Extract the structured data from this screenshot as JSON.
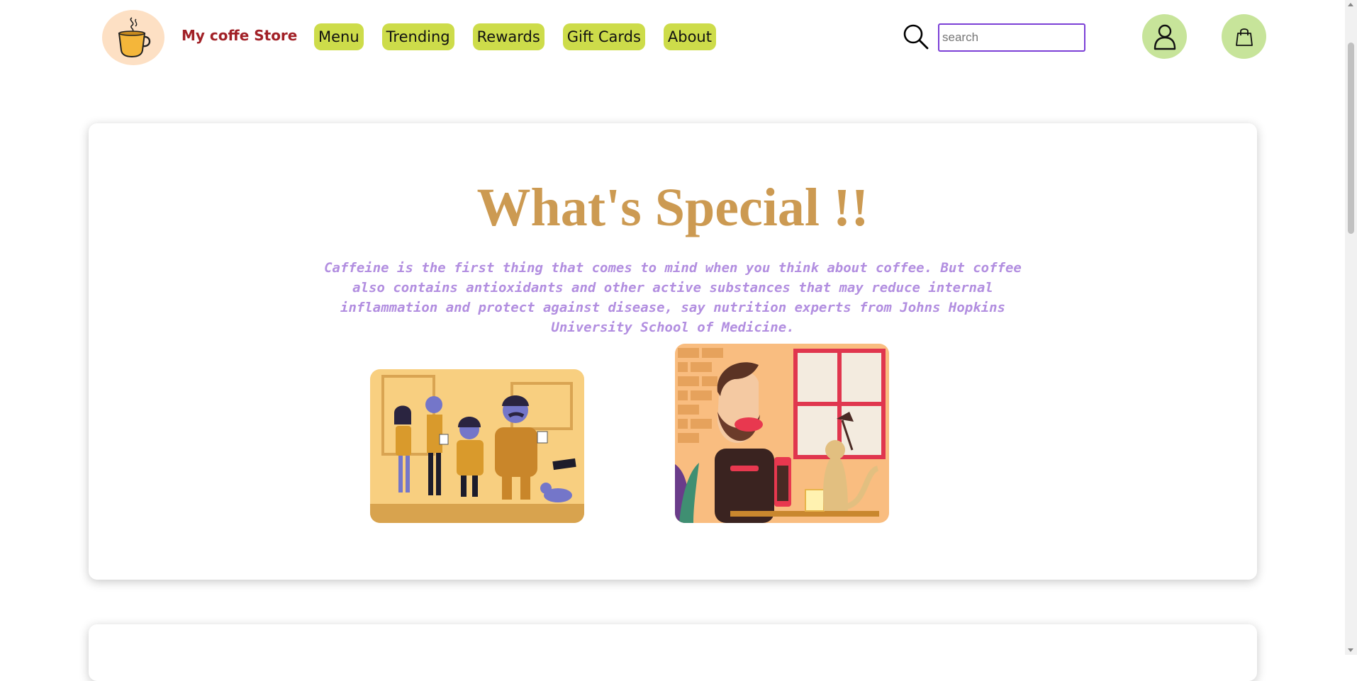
{
  "header": {
    "logo_icon": "coffee-cup-icon",
    "brand": "My coffe Store",
    "nav": [
      {
        "label": "Menu"
      },
      {
        "label": "Trending"
      },
      {
        "label": "Rewards"
      },
      {
        "label": "Gift Cards"
      },
      {
        "label": "About"
      }
    ],
    "search": {
      "placeholder": "search",
      "value": ""
    },
    "icons": {
      "search": "magnifier-icon",
      "user": "user-icon",
      "cart": "shopping-bag-icon"
    }
  },
  "special": {
    "title": "What's Special !!",
    "text": "Caffeine is the first thing that comes to mind when you think about coffee. But coffee also contains antioxidants and other active substances that may reduce internal inflammation and protect against disease, say nutrition experts from Johns Hopkins University School of Medicine.",
    "images": [
      {
        "name": "people-drinking-coffee-illustration"
      },
      {
        "name": "bearded-man-with-coffee-and-cat-illustration"
      }
    ]
  },
  "colors": {
    "brand": "#a12026",
    "nav_bg": "#cddc4a",
    "logo_bg": "#fde0c4",
    "circle_btn_bg": "#c7e49a",
    "title": "#cc9a52",
    "body_text": "#b28ee0",
    "search_border": "#7b3fd6"
  }
}
